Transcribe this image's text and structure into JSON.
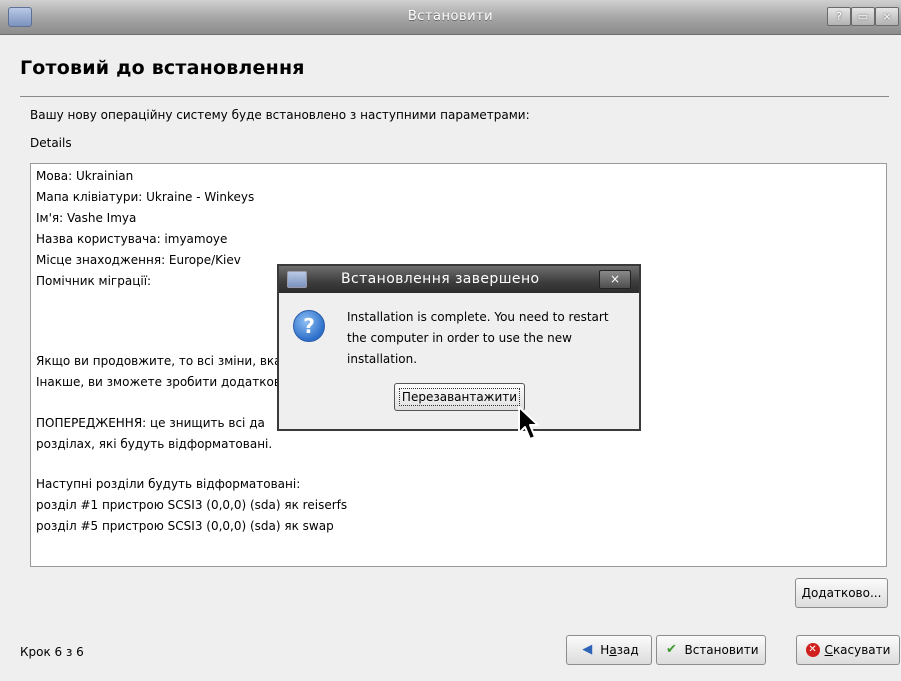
{
  "window": {
    "title": "Встановити",
    "buttons": {
      "help": "?",
      "maximize": "▭",
      "close": "×"
    }
  },
  "page": {
    "heading": "Готовий до встановлення",
    "intro": "Вашу нову операційну систему буде встановлено з наступними параметрами:",
    "details_label": "Details",
    "details_lines": [
      "Мова: Ukrainian",
      "Мапа клівіатури: Ukraine - Winkeys",
      "Ім'я: Vashe Imya",
      "Назва користувача: imyamoye",
      "Місце знаходження: Europe/Kiev",
      "Помічник міграції:",
      "Якщо ви продовжите, то всі зміни, вка",
      "Інакше, ви зможете зробити додатков",
      "ПОПЕРЕДЖЕННЯ: це знищить всі да",
      "розділах, які будуть відформатовані.",
      "Наступні розділи будуть відформатовані:",
      "розділ #1 пристрою SCSI3 (0,0,0) (sda) як reiserfs",
      "розділ #5 пристрою SCSI3 (0,0,0) (sda) як swap"
    ]
  },
  "buttons": {
    "more": "Додатково...",
    "back_prefix": "Н",
    "back_underlined": "а",
    "back_suffix": "зад",
    "install": "Встановити",
    "cancel_underlined": "С",
    "cancel_suffix": "касувати"
  },
  "footer": {
    "step": "Крок 6 з 6"
  },
  "dialog": {
    "title": "Встановлення завершено",
    "message": "Installation is complete. You need to restart the computer in order to use the new installation.",
    "restart_button": "Перезавантажити",
    "close": "×"
  },
  "icons": {
    "app": "installer-icon",
    "back": "arrow-left-icon",
    "install": "check-icon",
    "cancel": "cancel-icon",
    "question": "question-icon",
    "pointer": "mouse-pointer-icon"
  },
  "colors": {
    "dialog_title_bg": "#3d3d3d",
    "question_icon": "#2d6fc9",
    "cancel_icon": "#d0201e",
    "check_icon": "#3c9a2e"
  }
}
